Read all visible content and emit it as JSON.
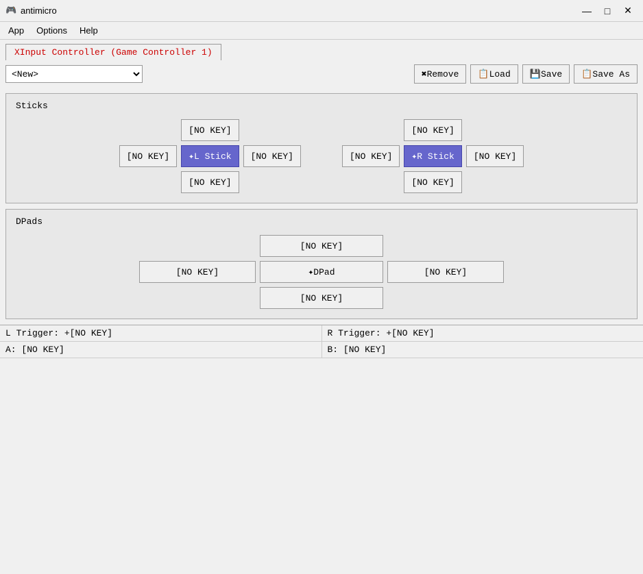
{
  "titleBar": {
    "icon": "🎮",
    "title": "antimicro",
    "minimizeLabel": "—",
    "maximizeLabel": "□",
    "closeLabel": "✕"
  },
  "menuBar": {
    "items": [
      {
        "id": "app",
        "label": "App"
      },
      {
        "id": "options",
        "label": "Options"
      },
      {
        "id": "help",
        "label": "Help"
      }
    ]
  },
  "tabs": [
    {
      "id": "controller1",
      "label": "XInput Controller (Game Controller 1)"
    }
  ],
  "toolbar": {
    "profilePlaceholder": "<New>",
    "removeLabel": "✖Remove",
    "loadLabel": "📋Load",
    "saveLabel": "💾Save",
    "saveAsLabel": "📋Save As"
  },
  "sticks": {
    "sectionLabel": "Sticks",
    "leftStick": {
      "up": "[NO KEY]",
      "left": "[NO KEY]",
      "center": "✦L Stick",
      "right": "[NO KEY]",
      "down": "[NO KEY]"
    },
    "rightStick": {
      "up": "[NO KEY]",
      "left": "[NO KEY]",
      "center": "✦R Stick",
      "right": "[NO KEY]",
      "down": "[NO KEY]"
    }
  },
  "dpads": {
    "sectionLabel": "DPads",
    "dpad": {
      "up": "[NO KEY]",
      "left": "[NO KEY]",
      "center": "✦DPad",
      "right": "[NO KEY]",
      "down": "[NO KEY]"
    }
  },
  "bottomBar": {
    "row1": {
      "left": "L Trigger: +[NO KEY]",
      "right": "R Trigger: +[NO KEY]"
    },
    "row2": {
      "left": "A:  [NO KEY]",
      "right": "B:  [NO KEY]"
    }
  }
}
